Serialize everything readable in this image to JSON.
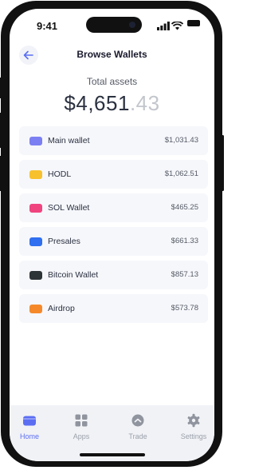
{
  "status_bar": {
    "time": "9:41"
  },
  "header": {
    "title": "Browse Wallets",
    "back_icon": "back-arrow-icon"
  },
  "summary": {
    "label": "Total assets",
    "amount_main": "$4,651",
    "amount_cents": ".43"
  },
  "wallets": [
    {
      "name": "Main wallet",
      "value": "$1,031.43",
      "color": "#7b7ff2",
      "icon": "wallet-icon"
    },
    {
      "name": "HODL",
      "value": "$1,062.51",
      "color": "#f7c12e",
      "icon": "wallet-icon"
    },
    {
      "name": "SOL Wallet",
      "value": "$465.25",
      "color": "#f0447f",
      "icon": "wallet-icon"
    },
    {
      "name": "Presales",
      "value": "$661.33",
      "color": "#2f6ff0",
      "icon": "wallet-icon"
    },
    {
      "name": "Bitcoin Wallet",
      "value": "$857.13",
      "color": "#2d3438",
      "icon": "wallet-icon"
    },
    {
      "name": "Airdrop",
      "value": "$573.78",
      "color": "#f5892a",
      "icon": "wallet-icon"
    }
  ],
  "tabbar": {
    "accent_color": "#5b6ef2",
    "inactive_color": "#9aa0aa",
    "items": [
      {
        "label": "Home",
        "icon": "wallet-icon",
        "active": true
      },
      {
        "label": "Apps",
        "icon": "grid-icon",
        "active": false
      },
      {
        "label": "Trade",
        "icon": "trade-icon",
        "active": false
      },
      {
        "label": "Settings",
        "icon": "gear-icon",
        "active": false
      }
    ]
  }
}
